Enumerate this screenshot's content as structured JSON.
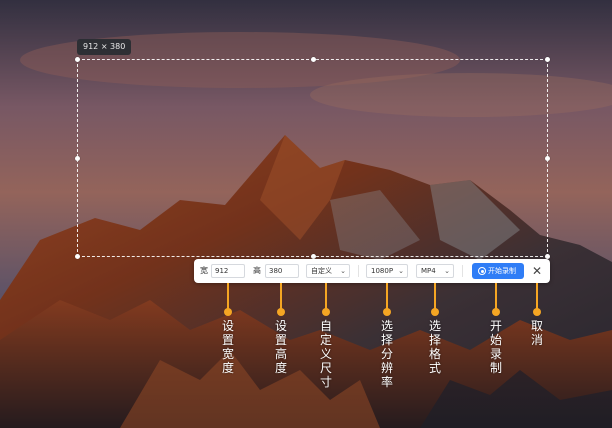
{
  "selection": {
    "size_label": "912 × 380"
  },
  "toolbar": {
    "width_label": "宽",
    "width_value": "912",
    "height_label": "高",
    "height_value": "380",
    "size_preset": "自定义",
    "resolution": "1080P",
    "format": "MP4",
    "start_label": "开始录制",
    "close_glyph": "✕"
  },
  "annotations": [
    {
      "id": "width",
      "text": "设置宽度"
    },
    {
      "id": "height",
      "text": "设置高度"
    },
    {
      "id": "custom-size",
      "text": "自定义尺寸"
    },
    {
      "id": "resolution",
      "text": "选择分辨率"
    },
    {
      "id": "format",
      "text": "选择格式"
    },
    {
      "id": "start",
      "text": "开始录制"
    },
    {
      "id": "cancel",
      "text": "取消"
    }
  ],
  "colors": {
    "accent": "#2f7df6",
    "callout": "#f5a623"
  }
}
